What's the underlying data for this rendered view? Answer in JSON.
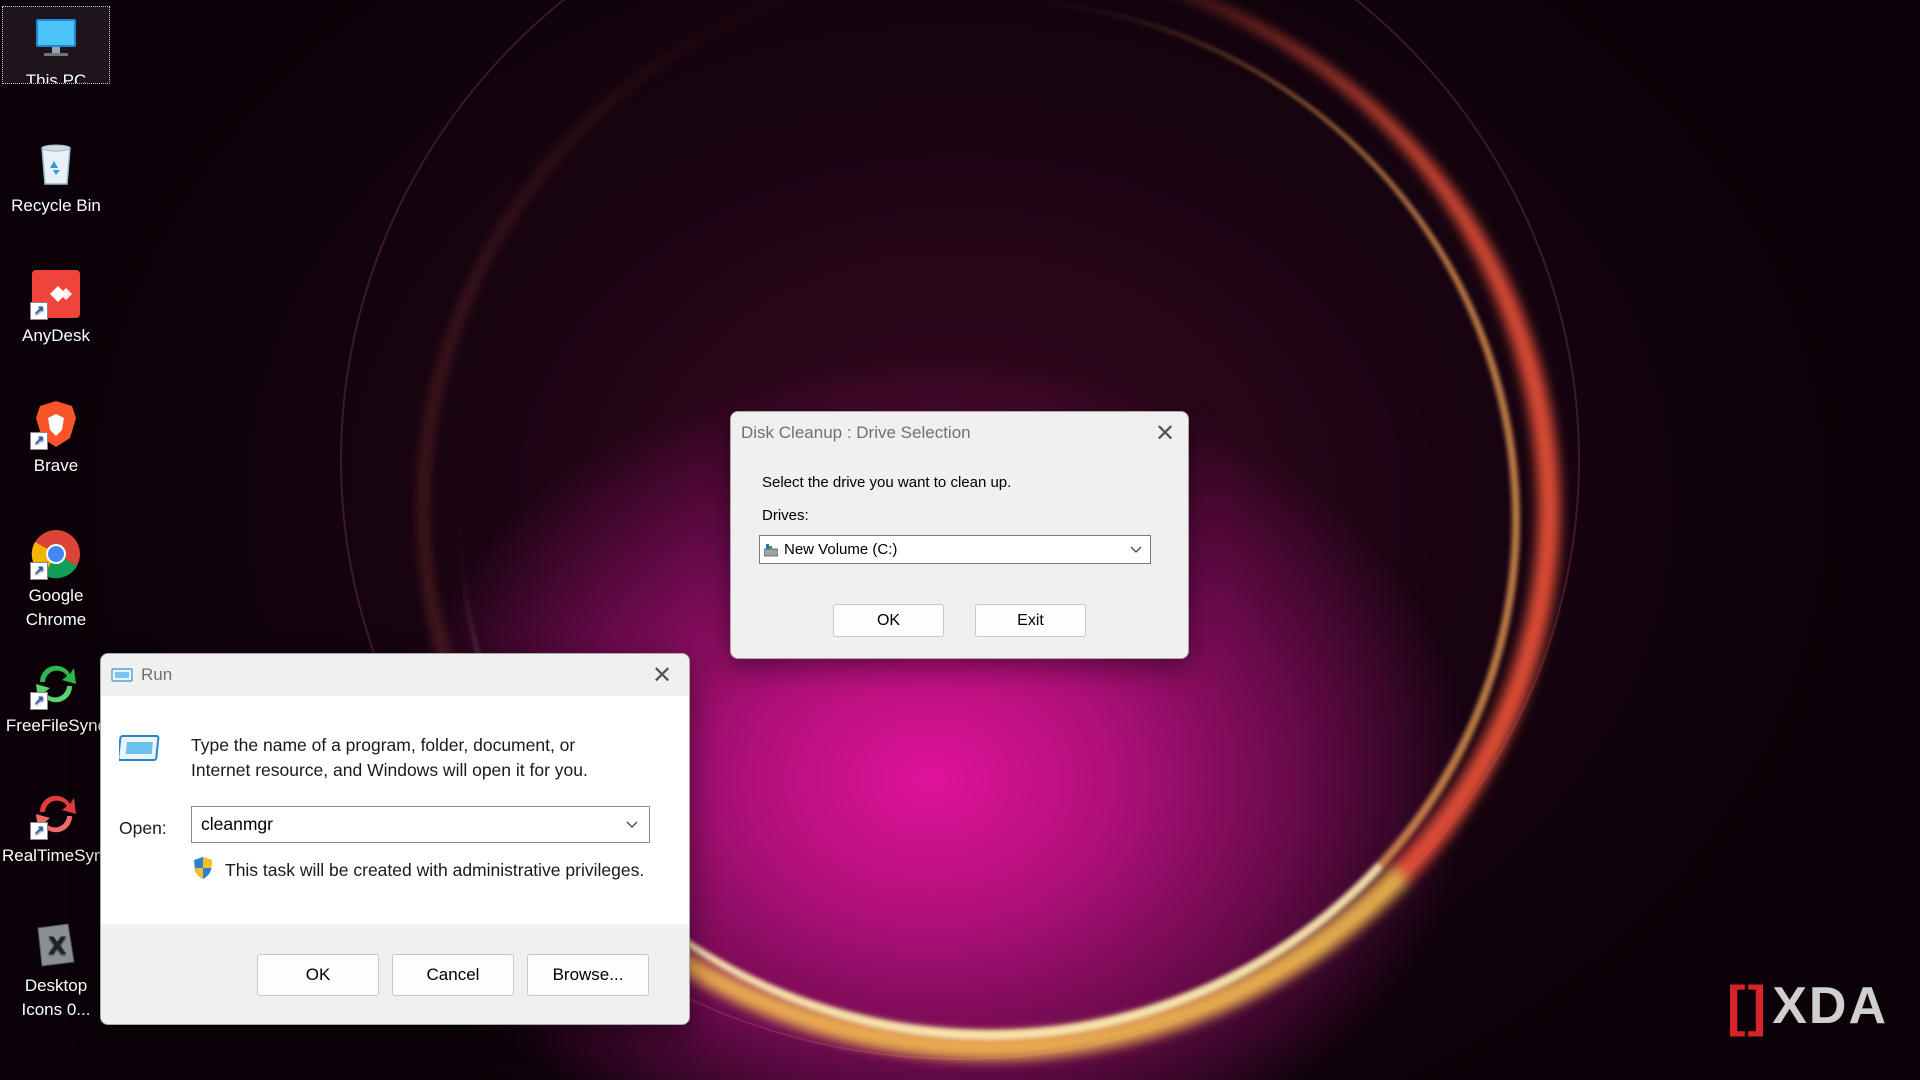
{
  "desktop": {
    "icons": [
      {
        "label": "This PC",
        "icon": "monitor-icon"
      },
      {
        "label": "Recycle Bin",
        "icon": "recycle-bin-icon"
      },
      {
        "label": "AnyDesk",
        "icon": "anydesk-icon"
      },
      {
        "label": "Brave",
        "icon": "brave-lion-icon"
      },
      {
        "label": "Google\nChrome",
        "icon": "chrome-icon"
      },
      {
        "label": "FreeFileSync",
        "icon": "freefilesync-icon"
      },
      {
        "label": "RealTimeSync",
        "icon": "realtimesync-icon"
      },
      {
        "label": "Desktop\nIcons 0...",
        "icon": "desktop-icons-x-icon"
      }
    ]
  },
  "disk_cleanup": {
    "title": "Disk Cleanup : Drive Selection",
    "prompt": "Select the drive you want to clean up.",
    "drives_label": "Drives:",
    "drive_value": "New Volume (C:)",
    "ok_label": "OK",
    "exit_label": "Exit"
  },
  "run_dialog": {
    "title": "Run",
    "description_line1": "Type the name of a program, folder, document, or",
    "description_line2": "Internet resource, and Windows will open it for you.",
    "open_label": "Open:",
    "open_value": "cleanmgr",
    "admin_note": "This task will be created with administrative privileges.",
    "ok_label": "OK",
    "cancel_label": "Cancel",
    "browse_label": "Browse..."
  },
  "watermark": {
    "text": "XDA"
  },
  "colors": {
    "brand_red": "#d8232a",
    "accent_blue": "#0078d4"
  }
}
